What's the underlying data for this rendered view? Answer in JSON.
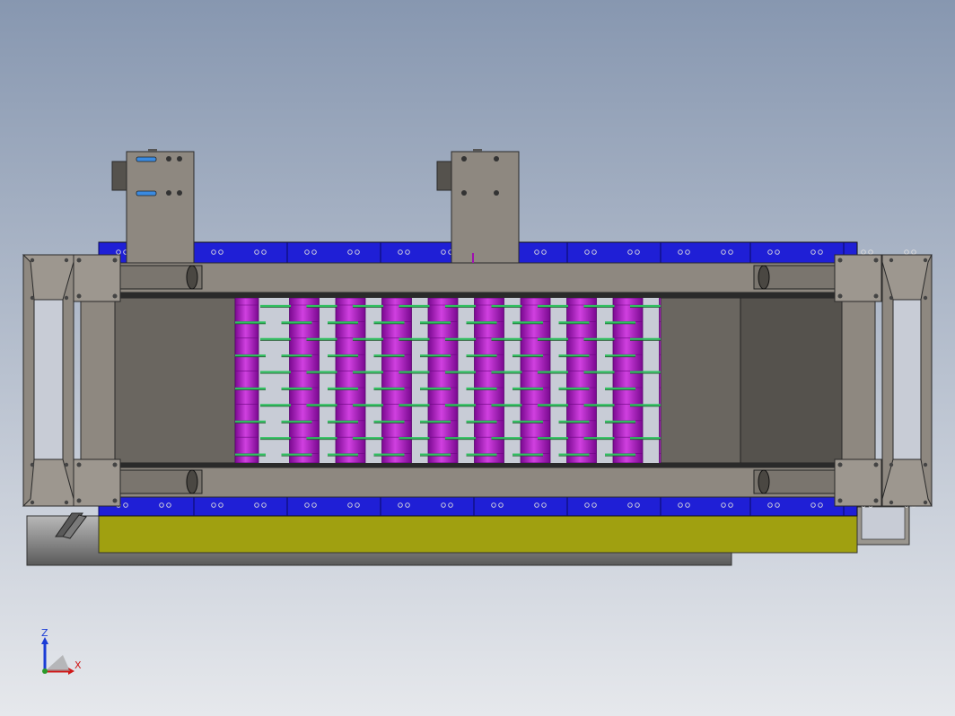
{
  "view": {
    "background_top": "#8797b0",
    "background_bottom": "#e6e8ec"
  },
  "model": {
    "frame_color": "#8e8880",
    "frame_edge": "#2a2a2a",
    "blue_belt_color": "#1f1fd6",
    "roller_color": "#a010b0",
    "roller_highlight": "#d040e0",
    "gap_color": "#c8ccd6",
    "green_pin_color": "#30c060",
    "panel_color": "#6a6660",
    "panel_dark": "#55524d",
    "base_color": "#a0a010",
    "pipe_color": "#9a9a9a",
    "roller_count": 10,
    "pin_rows": 10
  },
  "triad": {
    "z_label": "Z",
    "x_label": "X",
    "z_color": "#1a3cd6",
    "x_color": "#d01818"
  }
}
